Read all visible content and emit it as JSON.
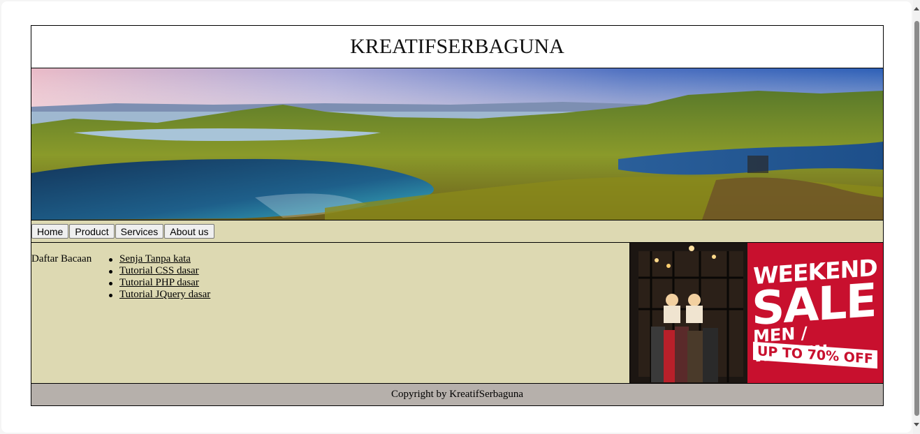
{
  "site": {
    "title": "KREATIFSERBAGUNA"
  },
  "banner": {
    "description_icon": "landscape-photo-icon"
  },
  "nav": {
    "items": [
      {
        "label": "Home"
      },
      {
        "label": "Product"
      },
      {
        "label": "Services"
      },
      {
        "label": "About us"
      }
    ]
  },
  "content": {
    "reading_label": "Daftar Bacaan",
    "reading_list": [
      {
        "label": "Senja Tanpa kata"
      },
      {
        "label": "Tutorial CSS dasar"
      },
      {
        "label": "Tutorial PHP dasar"
      },
      {
        "label": "Tutorial JQuery dasar"
      }
    ],
    "ad": {
      "line1": "WEEKEND",
      "line2": "SALE",
      "line3": "MEN / WOMEN",
      "line4": "UP TO 70% OFF"
    }
  },
  "footer": {
    "text": "Copyright by KreatifSerbaguna"
  },
  "colors": {
    "nav_bg": "#ddd9b2",
    "content_bg": "#ddd9b2",
    "footer_bg": "#b6b0ab",
    "sale_red": "#c8102e"
  }
}
